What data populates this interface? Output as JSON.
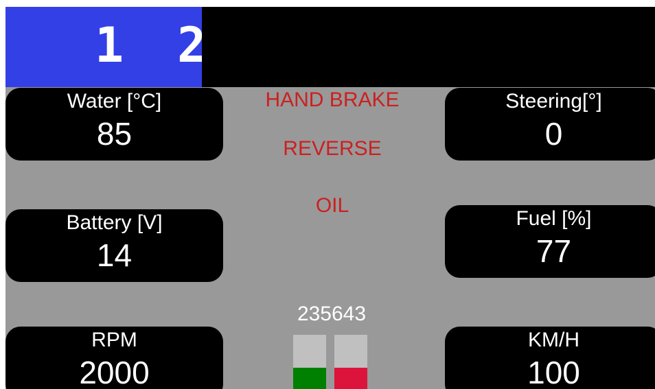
{
  "gear_indicator": {
    "numbers": [
      "1",
      "2"
    ]
  },
  "gauges": {
    "water": {
      "label": "Water [°C]",
      "value": "85"
    },
    "steering": {
      "label": "Steering[°]",
      "value": "0"
    },
    "battery": {
      "label": "Battery [V]",
      "value": "14"
    },
    "fuel": {
      "label": "Fuel [%]",
      "value": "77"
    },
    "rpm": {
      "label": "RPM",
      "value": "2000"
    },
    "speed": {
      "label": "KM/H",
      "value": "100"
    }
  },
  "warnings": {
    "hand_brake": "HAND BRAKE",
    "reverse": "REVERSE",
    "oil": "OIL"
  },
  "odometer": "235643",
  "level_bars": [
    {
      "level": 0.39,
      "color": "#008000"
    },
    {
      "level": 0.39,
      "color": "#dc143c"
    }
  ],
  "colors": {
    "background": "#999999",
    "tile": "#000000",
    "gear_strip": "#3340e6",
    "warning_text": "#cc2020",
    "bar_track": "#c0c0c0"
  }
}
